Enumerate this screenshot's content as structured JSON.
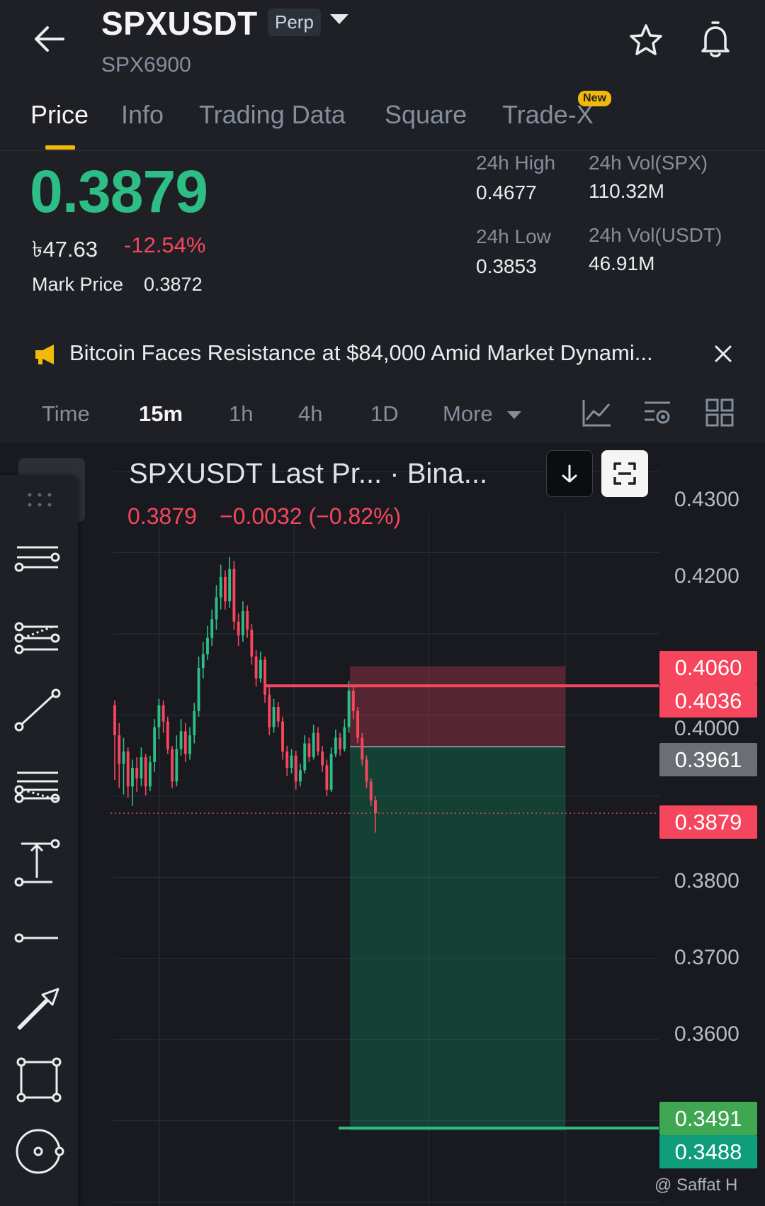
{
  "header": {
    "symbol": "SPXUSDT",
    "contract_type": "Perp",
    "subname": "SPX6900"
  },
  "tabs": [
    {
      "label": "Price",
      "active": true
    },
    {
      "label": "Info"
    },
    {
      "label": "Trading Data"
    },
    {
      "label": "Square"
    },
    {
      "label": "Trade-X",
      "badge": "New"
    }
  ],
  "price": {
    "last": "0.3879",
    "local": "৳47.63",
    "change_pct": "-12.54%",
    "mark_label": "Mark Price",
    "mark_value": "0.3872"
  },
  "stats": {
    "high_label": "24h High",
    "high_value": "0.4677",
    "low_label": "24h Low",
    "low_value": "0.3853",
    "vol_base_label": "24h Vol(SPX)",
    "vol_base_value": "110.32M",
    "vol_quote_label": "24h Vol(USDT)",
    "vol_quote_value": "46.91M"
  },
  "news": {
    "headline": "Bitcoin Faces Resistance at $84,000 Amid Market Dynami..."
  },
  "intervals": [
    "Time",
    "15m",
    "1h",
    "4h",
    "1D",
    "More"
  ],
  "active_interval": "15m",
  "chart": {
    "title": "SPXUSDT Last Pr...  · Bina...",
    "last_price": "0.3879",
    "change": "−0.0032 (−0.82%)",
    "axis_labels": [
      "0.4300",
      "0.4200",
      "0.4000",
      "0.3800",
      "0.3700",
      "0.3600"
    ],
    "tags": {
      "stop": "0.4060",
      "line": "0.4036",
      "entry": "0.3961",
      "current": "0.3879",
      "target": "0.3491",
      "target2": "0.3488"
    }
  },
  "chart_data": {
    "type": "candlestick",
    "title": "SPXUSDT Last Pr...  · Bina...",
    "y_ticks": [
      0.43,
      0.42,
      0.41,
      0.4,
      0.39,
      0.38,
      0.37,
      0.36,
      0.35,
      0.34
    ],
    "ylim": [
      0.3395,
      0.4335
    ],
    "last_price": 0.3879,
    "horizontal_lines": [
      {
        "value": 0.4036,
        "color": "#f6465d"
      },
      {
        "value": 0.3879,
        "color": "#f6465d",
        "style": "dotted"
      },
      {
        "value": 0.3491,
        "color": "#2ebd85"
      }
    ],
    "position_tool": {
      "direction": "short",
      "entry": 0.3961,
      "stop": 0.406,
      "target": 0.3488
    },
    "candles": [
      [
        0.4012,
        0.3975,
        0.4018,
        0.392
      ],
      [
        0.3975,
        0.394,
        0.399,
        0.391
      ],
      [
        0.394,
        0.3955,
        0.3972,
        0.3902
      ],
      [
        0.3955,
        0.3912,
        0.396,
        0.3898
      ],
      [
        0.3912,
        0.3935,
        0.3945,
        0.3888
      ],
      [
        0.3935,
        0.3922,
        0.3948,
        0.3905
      ],
      [
        0.3922,
        0.3948,
        0.396,
        0.3912
      ],
      [
        0.3948,
        0.3912,
        0.3952,
        0.3901
      ],
      [
        0.3912,
        0.3942,
        0.395,
        0.3906
      ],
      [
        0.3942,
        0.3985,
        0.3995,
        0.393
      ],
      [
        0.3985,
        0.4012,
        0.402,
        0.397
      ],
      [
        0.4012,
        0.3992,
        0.4018,
        0.3978
      ],
      [
        0.3992,
        0.3958,
        0.3998,
        0.3952
      ],
      [
        0.3958,
        0.3918,
        0.3962,
        0.391
      ],
      [
        0.3918,
        0.3958,
        0.3975,
        0.3912
      ],
      [
        0.3958,
        0.398,
        0.3995,
        0.395
      ],
      [
        0.398,
        0.3952,
        0.399,
        0.3942
      ],
      [
        0.3952,
        0.3975,
        0.3985,
        0.3945
      ],
      [
        0.3975,
        0.4005,
        0.4015,
        0.3965
      ],
      [
        0.4005,
        0.4058,
        0.4072,
        0.3998
      ],
      [
        0.4058,
        0.4075,
        0.409,
        0.4045
      ],
      [
        0.4075,
        0.4095,
        0.411,
        0.4068
      ],
      [
        0.4095,
        0.4118,
        0.413,
        0.4085
      ],
      [
        0.4118,
        0.4145,
        0.416,
        0.4105
      ],
      [
        0.4145,
        0.417,
        0.4185,
        0.413
      ],
      [
        0.417,
        0.414,
        0.4178,
        0.413
      ],
      [
        0.414,
        0.418,
        0.4195,
        0.4132
      ],
      [
        0.418,
        0.4115,
        0.419,
        0.4105
      ],
      [
        0.4115,
        0.4098,
        0.4125,
        0.4085
      ],
      [
        0.4098,
        0.4128,
        0.414,
        0.409
      ],
      [
        0.4128,
        0.4105,
        0.4135,
        0.4095
      ],
      [
        0.4105,
        0.4072,
        0.4112,
        0.4062
      ],
      [
        0.4072,
        0.4045,
        0.408,
        0.4035
      ],
      [
        0.4045,
        0.4068,
        0.4078,
        0.404
      ],
      [
        0.4068,
        0.4025,
        0.4072,
        0.4015
      ],
      [
        0.4025,
        0.3985,
        0.4035,
        0.3975
      ],
      [
        0.3985,
        0.401,
        0.402,
        0.3978
      ],
      [
        0.401,
        0.3992,
        0.4016,
        0.3985
      ],
      [
        0.3992,
        0.3955,
        0.3998,
        0.3945
      ],
      [
        0.3955,
        0.3935,
        0.3962,
        0.3925
      ],
      [
        0.3935,
        0.395,
        0.3958,
        0.3928
      ],
      [
        0.395,
        0.3918,
        0.3956,
        0.3908
      ],
      [
        0.3918,
        0.3932,
        0.394,
        0.3912
      ],
      [
        0.3932,
        0.3965,
        0.3975,
        0.3928
      ],
      [
        0.3965,
        0.3948,
        0.3972,
        0.3942
      ],
      [
        0.3948,
        0.3978,
        0.3988,
        0.3945
      ],
      [
        0.3978,
        0.3955,
        0.3985,
        0.395
      ],
      [
        0.3955,
        0.3938,
        0.3962,
        0.393
      ],
      [
        0.3938,
        0.3908,
        0.3945,
        0.39
      ],
      [
        0.3908,
        0.3952,
        0.396,
        0.3905
      ],
      [
        0.3952,
        0.3972,
        0.3982,
        0.3948
      ],
      [
        0.3972,
        0.3958,
        0.3978,
        0.395
      ],
      [
        0.3958,
        0.3985,
        0.3995,
        0.3955
      ],
      [
        0.3985,
        0.403,
        0.4042,
        0.3978
      ],
      [
        0.403,
        0.4005,
        0.4035,
        0.3995
      ],
      [
        0.4005,
        0.3972,
        0.401,
        0.3965
      ],
      [
        0.3972,
        0.3945,
        0.3978,
        0.3938
      ],
      [
        0.3945,
        0.3918,
        0.395,
        0.391
      ],
      [
        0.3918,
        0.3895,
        0.3922,
        0.3888
      ],
      [
        0.3895,
        0.3879,
        0.39,
        0.3855
      ]
    ]
  },
  "toolbar": [
    "horizontal-ray-tool",
    "parallel-channel-tool",
    "trend-line-tool",
    "fib-retracement-tool",
    "price-range-tool",
    "horizontal-line-tool",
    "arrow-tool",
    "rectangle-tool",
    "circle-tool"
  ],
  "watermark": "@ Saffat H",
  "colors": {
    "up": "#2ebd85",
    "down": "#f6465d",
    "accent": "#f0b90b",
    "background": "#1e2026",
    "chart_background": "#181a20"
  }
}
